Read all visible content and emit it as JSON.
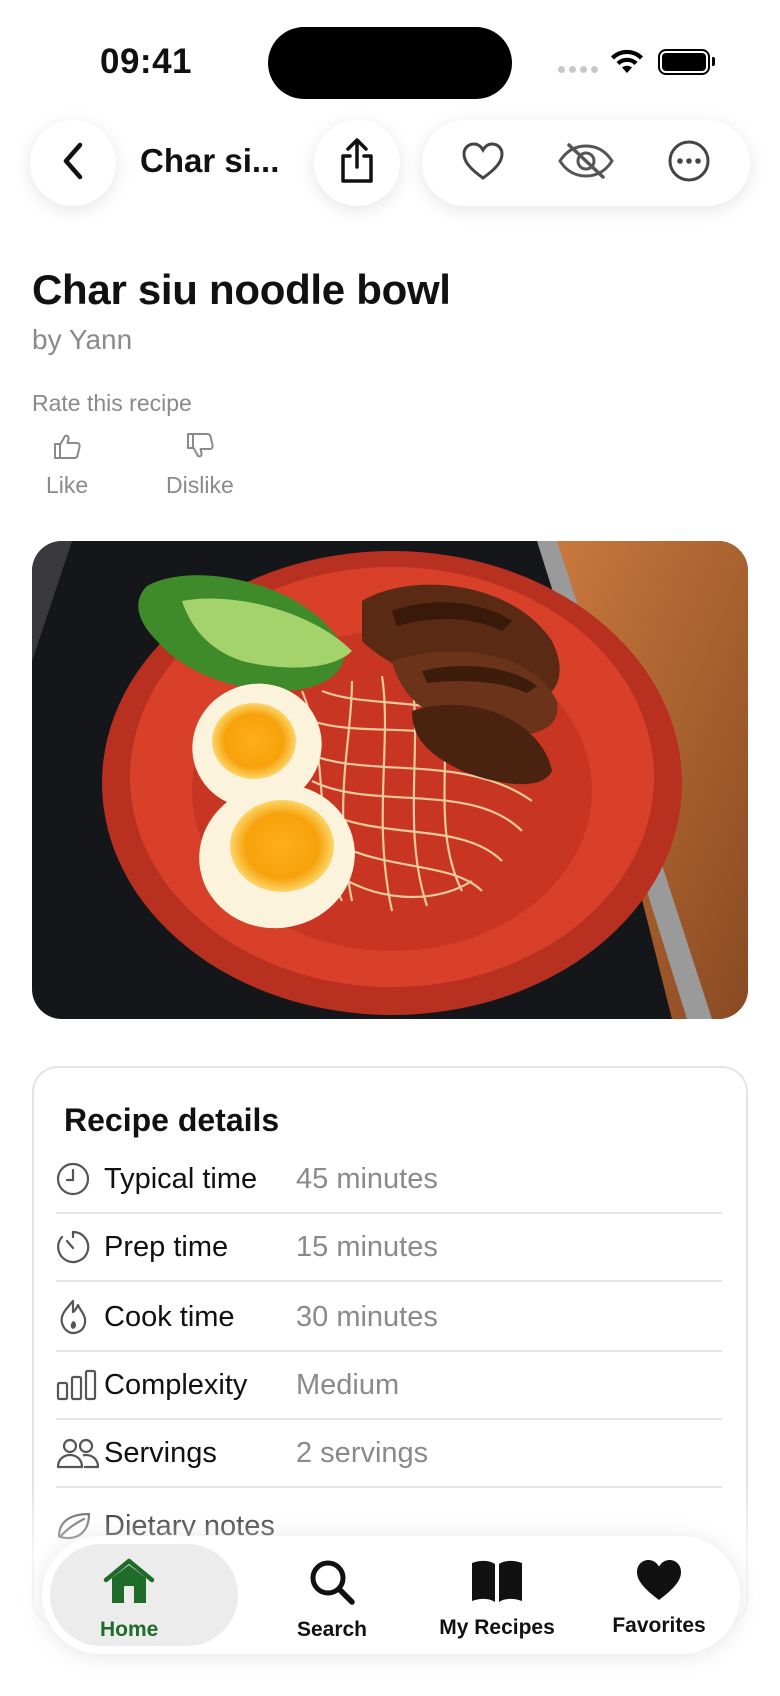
{
  "status_bar": {
    "time": "09:41"
  },
  "nav": {
    "title": "Char si..."
  },
  "recipe": {
    "title": "Char siu noodle bowl",
    "author": "by Yann",
    "rate_label": "Rate this recipe",
    "like_label": "Like",
    "dislike_label": "Dislike"
  },
  "details": {
    "title": "Recipe details",
    "rows": [
      {
        "icon": "clock-icon",
        "label": "Typical time",
        "value": "45 minutes"
      },
      {
        "icon": "timer-icon",
        "label": "Prep time",
        "value": "15 minutes"
      },
      {
        "icon": "flame-icon",
        "label": "Cook time",
        "value": "30 minutes"
      },
      {
        "icon": "bars-icon",
        "label": "Complexity",
        "value": "Medium"
      },
      {
        "icon": "people-icon",
        "label": "Servings",
        "value": "2 servings"
      },
      {
        "icon": "leaf-icon",
        "label": "Dietary notes",
        "value": ""
      }
    ]
  },
  "tabs": [
    {
      "label": "Home",
      "icon": "home-icon",
      "active": true
    },
    {
      "label": "Search",
      "icon": "search-icon"
    },
    {
      "label": "My Recipes",
      "icon": "book-icon"
    },
    {
      "label": "Favorites",
      "icon": "heart-icon"
    }
  ],
  "colors": {
    "accent": "#1f6b2a",
    "muted": "#8a8a8a",
    "bowl": "#d8402a"
  }
}
